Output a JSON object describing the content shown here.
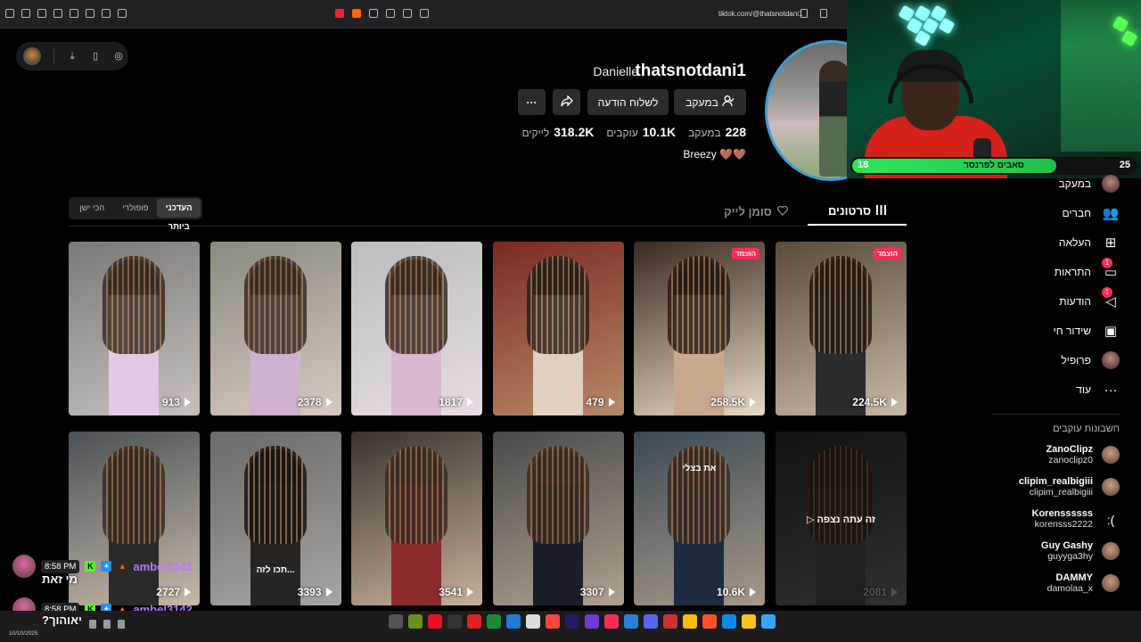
{
  "browser": {
    "url": "tiktok.com/@thatsnotdani1"
  },
  "profile": {
    "username": "thatsnotdani1",
    "nickname": "Danielle",
    "buttons": {
      "following": "במעקב",
      "message": "לשלוח הודעה",
      "more": "···"
    },
    "stats": [
      {
        "value": "228",
        "label": "במעקב"
      },
      {
        "value": "10.1K",
        "label": "עוקבים"
      },
      {
        "value": "318.2K",
        "label": "לייקים"
      }
    ],
    "bio": "Breezy"
  },
  "stream": {
    "goal_label": "סאבים לפרנסר",
    "goal_current": "18",
    "goal_target": "25",
    "goal_progress": 0.72
  },
  "tabs": {
    "videos": "סרטונים",
    "liked": "סומן לייק"
  },
  "sort": {
    "options": [
      "הכי ישן",
      "פופולרי",
      "העדכני ביותר"
    ],
    "active": "העדכני ביותר"
  },
  "videos": [
    {
      "views": "224.5K",
      "pinned": "הוצמד",
      "caption": ""
    },
    {
      "views": "258.5K",
      "pinned": "הוצמד",
      "caption": ""
    },
    {
      "views": "479",
      "pinned": "",
      "caption": ""
    },
    {
      "views": "1817",
      "pinned": "",
      "caption": ""
    },
    {
      "views": "2378",
      "pinned": "",
      "caption": ""
    },
    {
      "views": "913",
      "pinned": "",
      "caption": ""
    },
    {
      "views": "2081",
      "pinned": "",
      "caption": "זה עתה נצפה"
    },
    {
      "views": "10.6K",
      "pinned": "",
      "caption": "את בצלי"
    },
    {
      "views": "3307",
      "pinned": "",
      "caption": ""
    },
    {
      "views": "3541",
      "pinned": "",
      "caption": ""
    },
    {
      "views": "3393",
      "pinned": "",
      "caption": "תכו לזה..."
    },
    {
      "views": "2727",
      "pinned": "",
      "caption": ""
    }
  ],
  "sidebar": {
    "items": [
      {
        "label": "במעקב",
        "icon": "following-avatar"
      },
      {
        "label": "חברים",
        "icon": "friends-icon"
      },
      {
        "label": "העלאה",
        "icon": "upload-icon"
      },
      {
        "label": "התראות",
        "icon": "inbox-icon",
        "badge": "1"
      },
      {
        "label": "הודעות",
        "icon": "messages-icon",
        "badge": "1"
      },
      {
        "label": "שידור חי",
        "icon": "live-icon"
      },
      {
        "label": "פרופיל",
        "icon": "profile-avatar"
      },
      {
        "label": "עוד",
        "icon": "more-icon"
      }
    ],
    "following_title": "חשבונות עוקבים",
    "accounts": [
      {
        "name": "ZanoClipz",
        "handle": "zanoclipz0"
      },
      {
        "name": "clipim_realbigiii",
        "handle": "clipim_realbigiii"
      },
      {
        "name": "Korenssssss",
        "handle": "korensss2222",
        "avatar": ":("
      },
      {
        "name": "Guy Gashy",
        "handle": "guyyga3hy"
      },
      {
        "name": "DAMMY",
        "handle": "damolaa_x"
      }
    ]
  },
  "chat": [
    {
      "time": "8:58 PM",
      "user": "ambel3142",
      "message": "מי זאת"
    },
    {
      "time": "8:58 PM",
      "user": "ambel3142",
      "message": "?יאוהוך"
    }
  ],
  "taskbar": {
    "date": "10/10/2025"
  }
}
